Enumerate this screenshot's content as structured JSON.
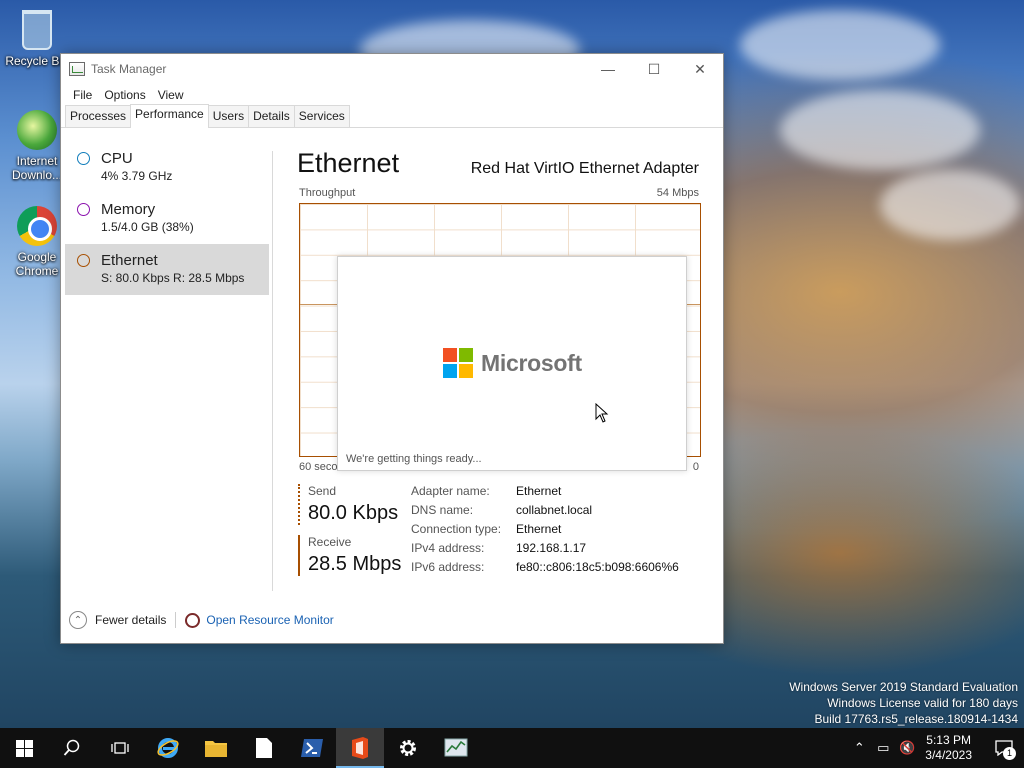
{
  "desktop": {
    "icons": [
      {
        "label": "Recycle Bin"
      },
      {
        "label": "Internet Downlo..."
      },
      {
        "label": "Google Chrome"
      }
    ]
  },
  "window": {
    "title": "Task Manager",
    "controls": {
      "minimize": "—",
      "maximize": "☐",
      "close": "✕"
    },
    "menu": [
      "File",
      "Options",
      "View"
    ],
    "tabs": [
      "Processes",
      "Performance",
      "Users",
      "Details",
      "Services"
    ],
    "active_tab": "Performance"
  },
  "sidebar": {
    "items": [
      {
        "name": "CPU",
        "detail": "4% 3.79 GHz",
        "color": "#117dbb"
      },
      {
        "name": "Memory",
        "detail": "1.5/4.0 GB (38%)",
        "color": "#8b12ae"
      },
      {
        "name": "Ethernet",
        "detail": "S: 80.0 Kbps R: 28.5 Mbps",
        "color": "#a74f01"
      }
    ]
  },
  "main": {
    "title": "Ethernet",
    "adapter": "Red Hat VirtIO Ethernet Adapter",
    "throughput_label": "Throughput",
    "throughput_max": "54 Mbps",
    "axis_left": "60 seconds",
    "axis_right": "0",
    "send": {
      "label": "Send",
      "value": "80.0 Kbps"
    },
    "receive": {
      "label": "Receive",
      "value": "28.5 Mbps"
    },
    "details": [
      {
        "key": "Adapter name:",
        "value": "Ethernet"
      },
      {
        "key": "DNS name:",
        "value": "collabnet.local"
      },
      {
        "key": "Connection type:",
        "value": "Ethernet"
      },
      {
        "key": "IPv4 address:",
        "value": "192.168.1.17"
      },
      {
        "key": "IPv6 address:",
        "value": "fe80::c806:18c5:b098:6606%6"
      }
    ]
  },
  "footer": {
    "fewer_details": "Fewer details",
    "open_resmon": "Open Resource Monitor"
  },
  "splash": {
    "brand": "Microsoft",
    "message": "We're getting things ready...",
    "logo_colors": [
      "#f25022",
      "#7fba00",
      "#00a4ef",
      "#ffb900"
    ]
  },
  "watermark": {
    "line1": "Windows Server 2019 Standard Evaluation",
    "line2": "Windows License valid for 180 days",
    "line3": "Build 17763.rs5_release.180914-1434"
  },
  "taskbar": {
    "clock_time": "5:13 PM",
    "clock_date": "3/4/2023",
    "notification_count": "1"
  }
}
